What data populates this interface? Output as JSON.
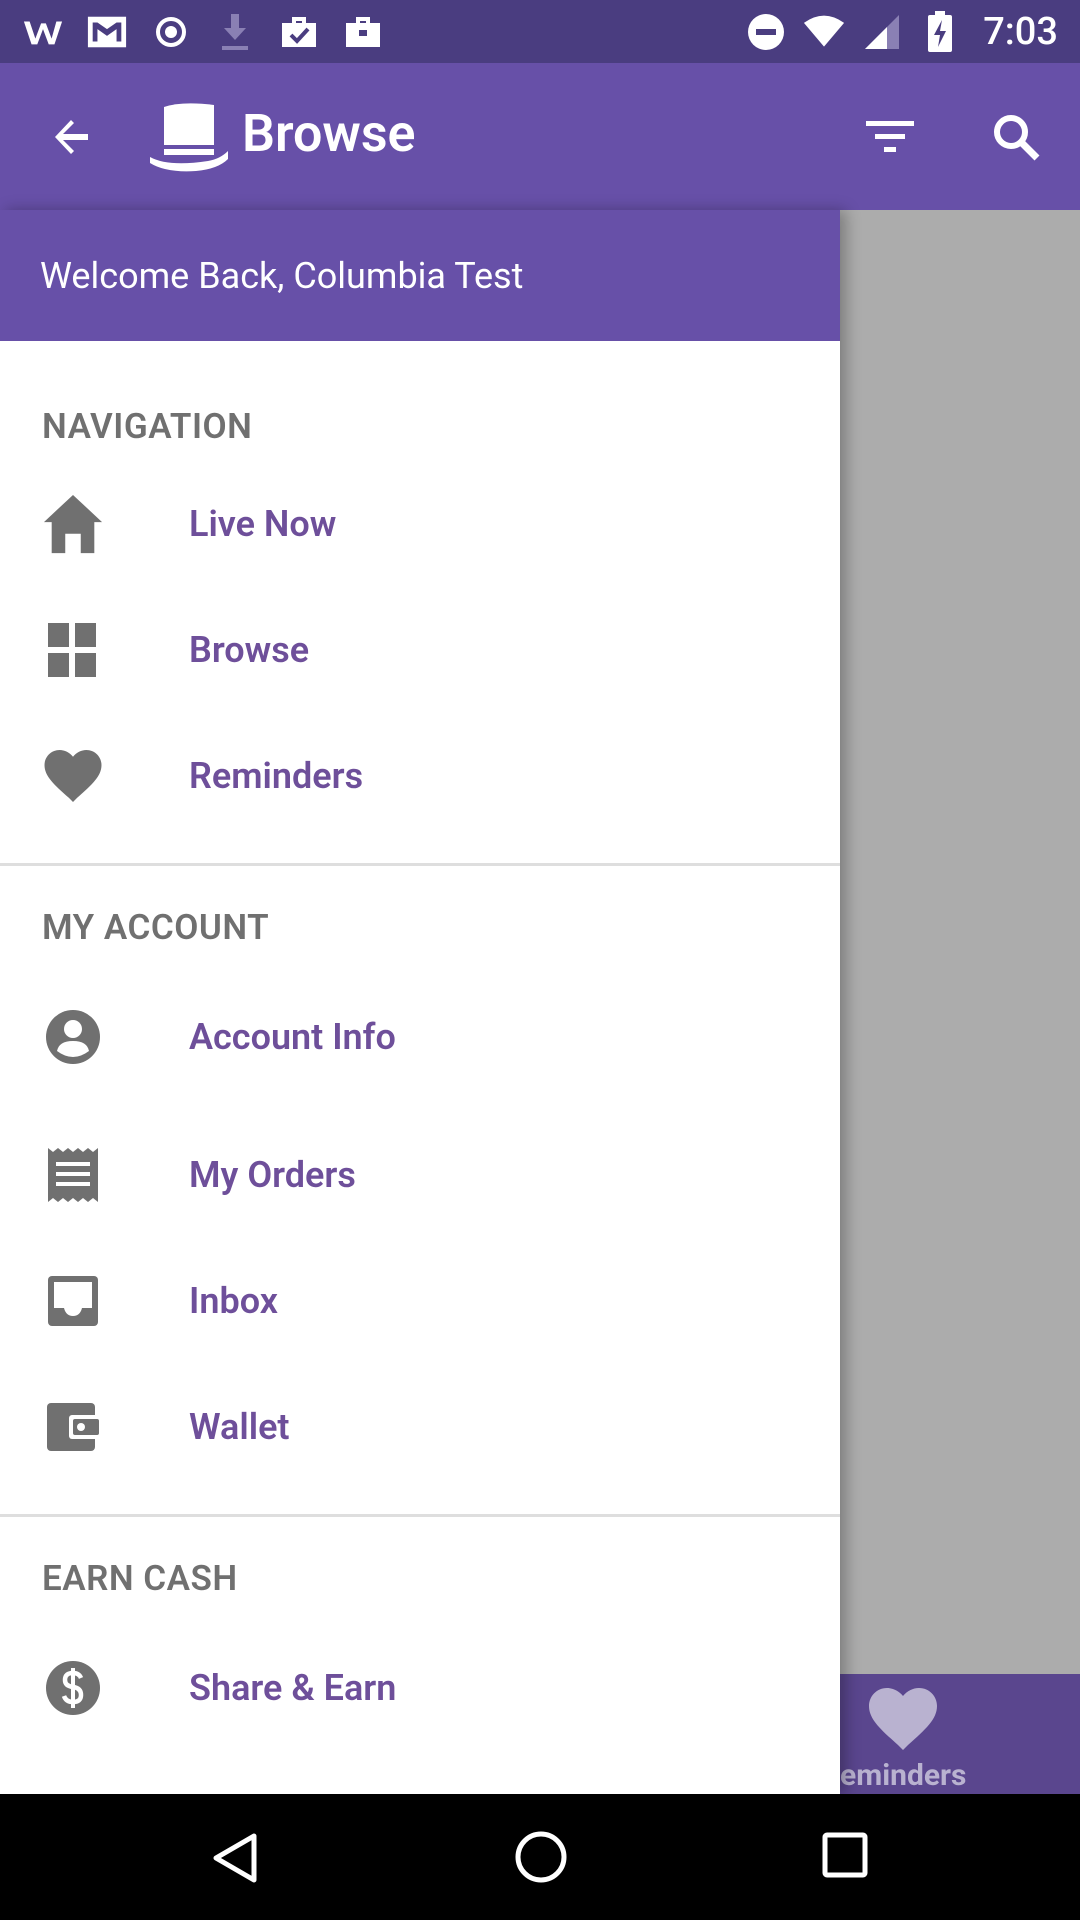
{
  "status_bar": {
    "time": "7:03",
    "left_icons": [
      "wattpad-icon",
      "gmail-icon",
      "record-icon",
      "download-icon",
      "briefcase-check-icon",
      "briefcase-icon"
    ],
    "right_icons": [
      "do-not-disturb-icon",
      "wifi-icon",
      "signal-icon",
      "battery-charging-icon"
    ]
  },
  "app_bar": {
    "title": "Browse",
    "background": "#6750a8"
  },
  "drawer": {
    "welcome": "Welcome Back, Columbia Test",
    "sections": [
      {
        "title": "NAVIGATION",
        "items": [
          {
            "label": "Live Now",
            "icon": "home-icon"
          },
          {
            "label": "Browse",
            "icon": "grid-icon"
          },
          {
            "label": "Reminders",
            "icon": "heart-icon"
          }
        ]
      },
      {
        "title": "MY ACCOUNT",
        "items": [
          {
            "label": "Account Info",
            "icon": "account-circle-icon"
          },
          {
            "label": "My Orders",
            "icon": "receipt-icon"
          },
          {
            "label": "Inbox",
            "icon": "inbox-icon"
          },
          {
            "label": "Wallet",
            "icon": "wallet-icon"
          }
        ]
      },
      {
        "title": "EARN CASH",
        "items": [
          {
            "label": "Share & Earn",
            "icon": "dollar-circle-icon"
          }
        ]
      }
    ]
  },
  "bottom_tab": {
    "label": "Reminders",
    "visible_label": "eminders"
  },
  "colors": {
    "accent": "#6e4f9a",
    "status_bar": "#4a3d80",
    "icon_gray": "#707070"
  }
}
